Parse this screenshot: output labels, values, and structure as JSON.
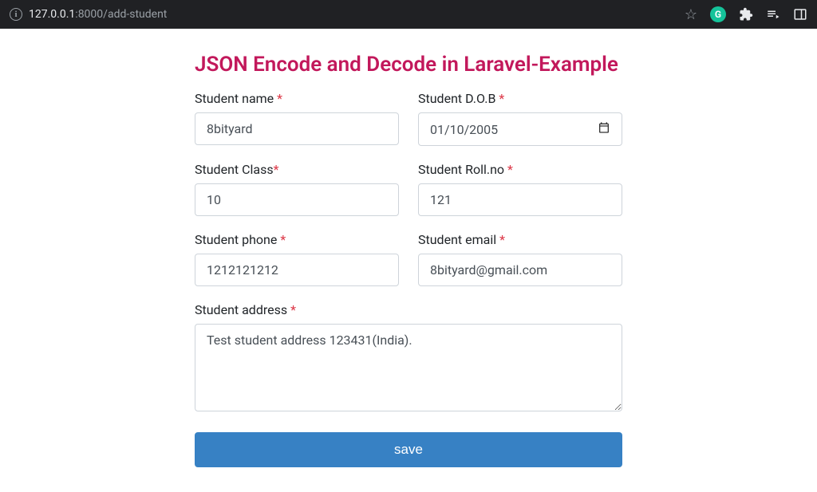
{
  "browser": {
    "url_host": "127.0.0.1",
    "url_port": ":8000",
    "url_path": "/add-student",
    "grammarly": "G"
  },
  "page": {
    "title": "JSON Encode and Decode in Laravel-Example"
  },
  "form": {
    "name": {
      "label": "Student name ",
      "value": "8bityard"
    },
    "dob": {
      "label": "Student D.O.B ",
      "value": "01/10/2005"
    },
    "class": {
      "label": "Student Class",
      "value": "10"
    },
    "rollno": {
      "label": "Student Roll.no ",
      "value": "121"
    },
    "phone": {
      "label": "Student phone ",
      "value": "1212121212"
    },
    "email": {
      "label": "Student email ",
      "value": "8bityard@gmail.com"
    },
    "address": {
      "label": "Student address ",
      "value": "Test student address 123431(India)."
    },
    "save_label": "save",
    "required": "*"
  }
}
